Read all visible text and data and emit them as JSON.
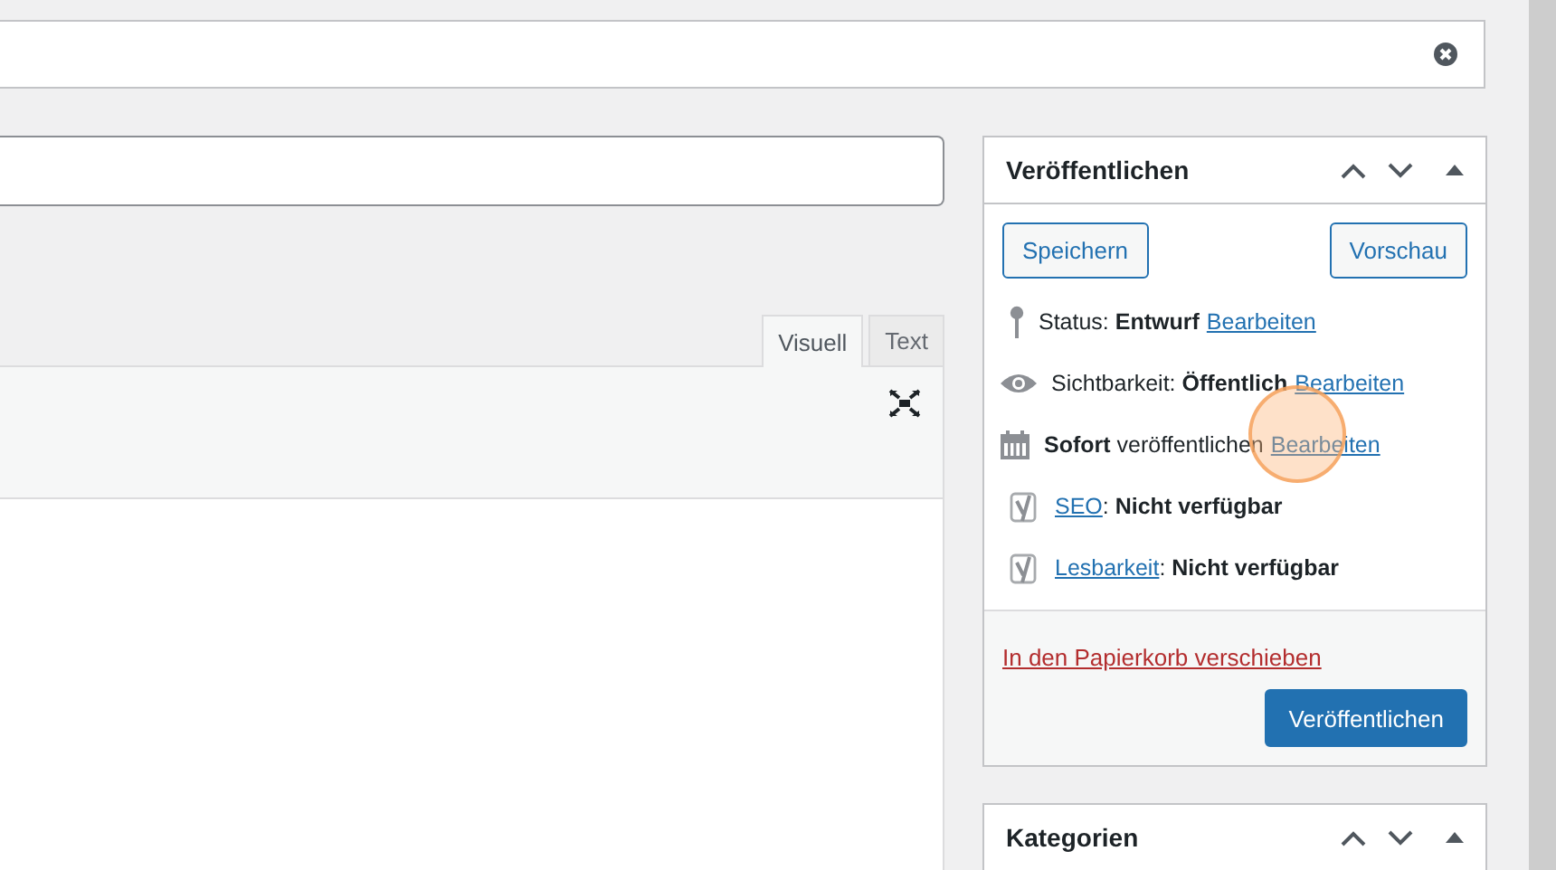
{
  "top_field": {
    "clearable": true
  },
  "editor": {
    "tabs": [
      {
        "label": "Visuell",
        "selected": true
      },
      {
        "label": "Text",
        "selected": false
      }
    ]
  },
  "publish_box": {
    "title": "Veröffentlichen",
    "buttons": [
      "Speichern",
      "Vorschau"
    ],
    "rows": [
      {
        "kind": "pin",
        "text": "Status: **Entwurf**",
        "link": "Bearbeiten"
      },
      {
        "kind": "eye",
        "text": "Sichtbarkeit: **Öffentlich**",
        "link": "Bearbeiten"
      },
      {
        "kind": "calendar",
        "text": "**Sofort** veröffentlichen",
        "link": "Bearbeiten"
      },
      {
        "kind": "yoast",
        "lead_link": "SEO",
        "text": ": **Nicht verfügbar**"
      },
      {
        "kind": "yoast",
        "lead_link": "Lesbarkeit",
        "text": ": **Nicht verfügbar**"
      }
    ],
    "trash_link": "In den Papierkorb verschieben",
    "publish_button": "Veröffentlichen"
  },
  "categories_box": {
    "title": "Kategorien"
  }
}
